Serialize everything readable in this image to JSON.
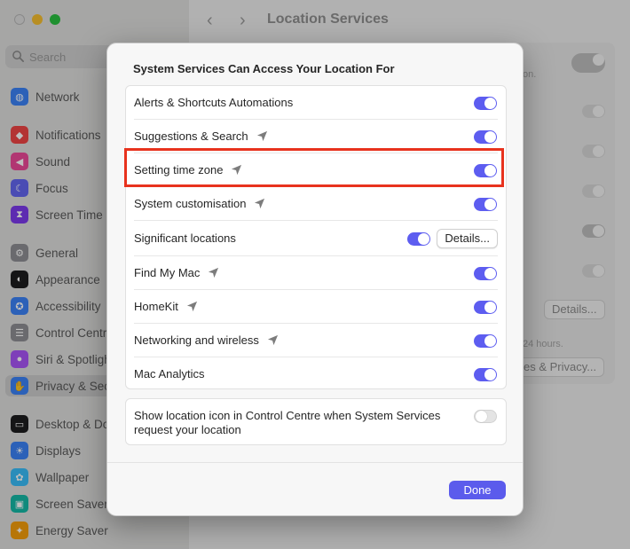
{
  "window": {
    "title": "Location Services"
  },
  "sidebar": {
    "search_placeholder": "Search",
    "items": [
      {
        "label": "Network",
        "icon": "globe-icon",
        "color": "#3b82f6"
      },
      {
        "label": "Notifications",
        "icon": "bell-icon",
        "color": "#ef4444"
      },
      {
        "label": "Sound",
        "icon": "speaker-icon",
        "color": "#ec4899"
      },
      {
        "label": "Focus",
        "icon": "moon-icon",
        "color": "#6366f1"
      },
      {
        "label": "Screen Time",
        "icon": "hourglass-icon",
        "color": "#7c3aed"
      },
      {
        "label": "General",
        "icon": "gear-icon",
        "color": "#8e8e93"
      },
      {
        "label": "Appearance",
        "icon": "appearance-icon",
        "color": "#1c1c1e"
      },
      {
        "label": "Accessibility",
        "icon": "accessibility-icon",
        "color": "#3b82f6"
      },
      {
        "label": "Control Centre",
        "icon": "control-centre-icon",
        "color": "#8e8e93"
      },
      {
        "label": "Siri & Spotlight",
        "icon": "siri-icon",
        "color": "#a855f7"
      },
      {
        "label": "Privacy & Security",
        "icon": "hand-icon",
        "color": "#3b82f6"
      },
      {
        "label": "Desktop & Dock",
        "icon": "dock-icon",
        "color": "#1c1c1e"
      },
      {
        "label": "Displays",
        "icon": "sun-icon",
        "color": "#3b82f6"
      },
      {
        "label": "Wallpaper",
        "icon": "wallpaper-icon",
        "color": "#38bdf8"
      },
      {
        "label": "Screen Saver",
        "icon": "screensaver-icon",
        "color": "#14b8a6"
      },
      {
        "label": "Energy Saver",
        "icon": "bulb-icon",
        "color": "#f59e0b"
      }
    ]
  },
  "background": {
    "text_partial_1": "on.",
    "text_partial_2": "24 hours.",
    "details_label": "Details...",
    "privacy_button": "es & Privacy..."
  },
  "dialog": {
    "title": "System Services Can Access Your Location For",
    "rows": [
      {
        "label": "Alerts & Shortcuts Automations",
        "arrow": false,
        "on": true
      },
      {
        "label": "Suggestions & Search",
        "arrow": true,
        "on": true
      },
      {
        "label": "Setting time zone",
        "arrow": true,
        "on": true
      },
      {
        "label": "System customisation",
        "arrow": true,
        "on": true
      },
      {
        "label": "Significant locations",
        "arrow": false,
        "on": true,
        "button": "Details..."
      },
      {
        "label": "Find My Mac",
        "arrow": true,
        "on": true
      },
      {
        "label": "HomeKit",
        "arrow": true,
        "on": true
      },
      {
        "label": "Networking and wireless",
        "arrow": true,
        "on": true
      },
      {
        "label": "Mac Analytics",
        "arrow": false,
        "on": true
      }
    ],
    "show_icon_label": "Show location icon in Control Centre when System Services request your location",
    "show_icon_on": false,
    "done_label": "Done"
  },
  "colors": {
    "accent": "#5b5bec",
    "highlight": "#e8321d"
  }
}
